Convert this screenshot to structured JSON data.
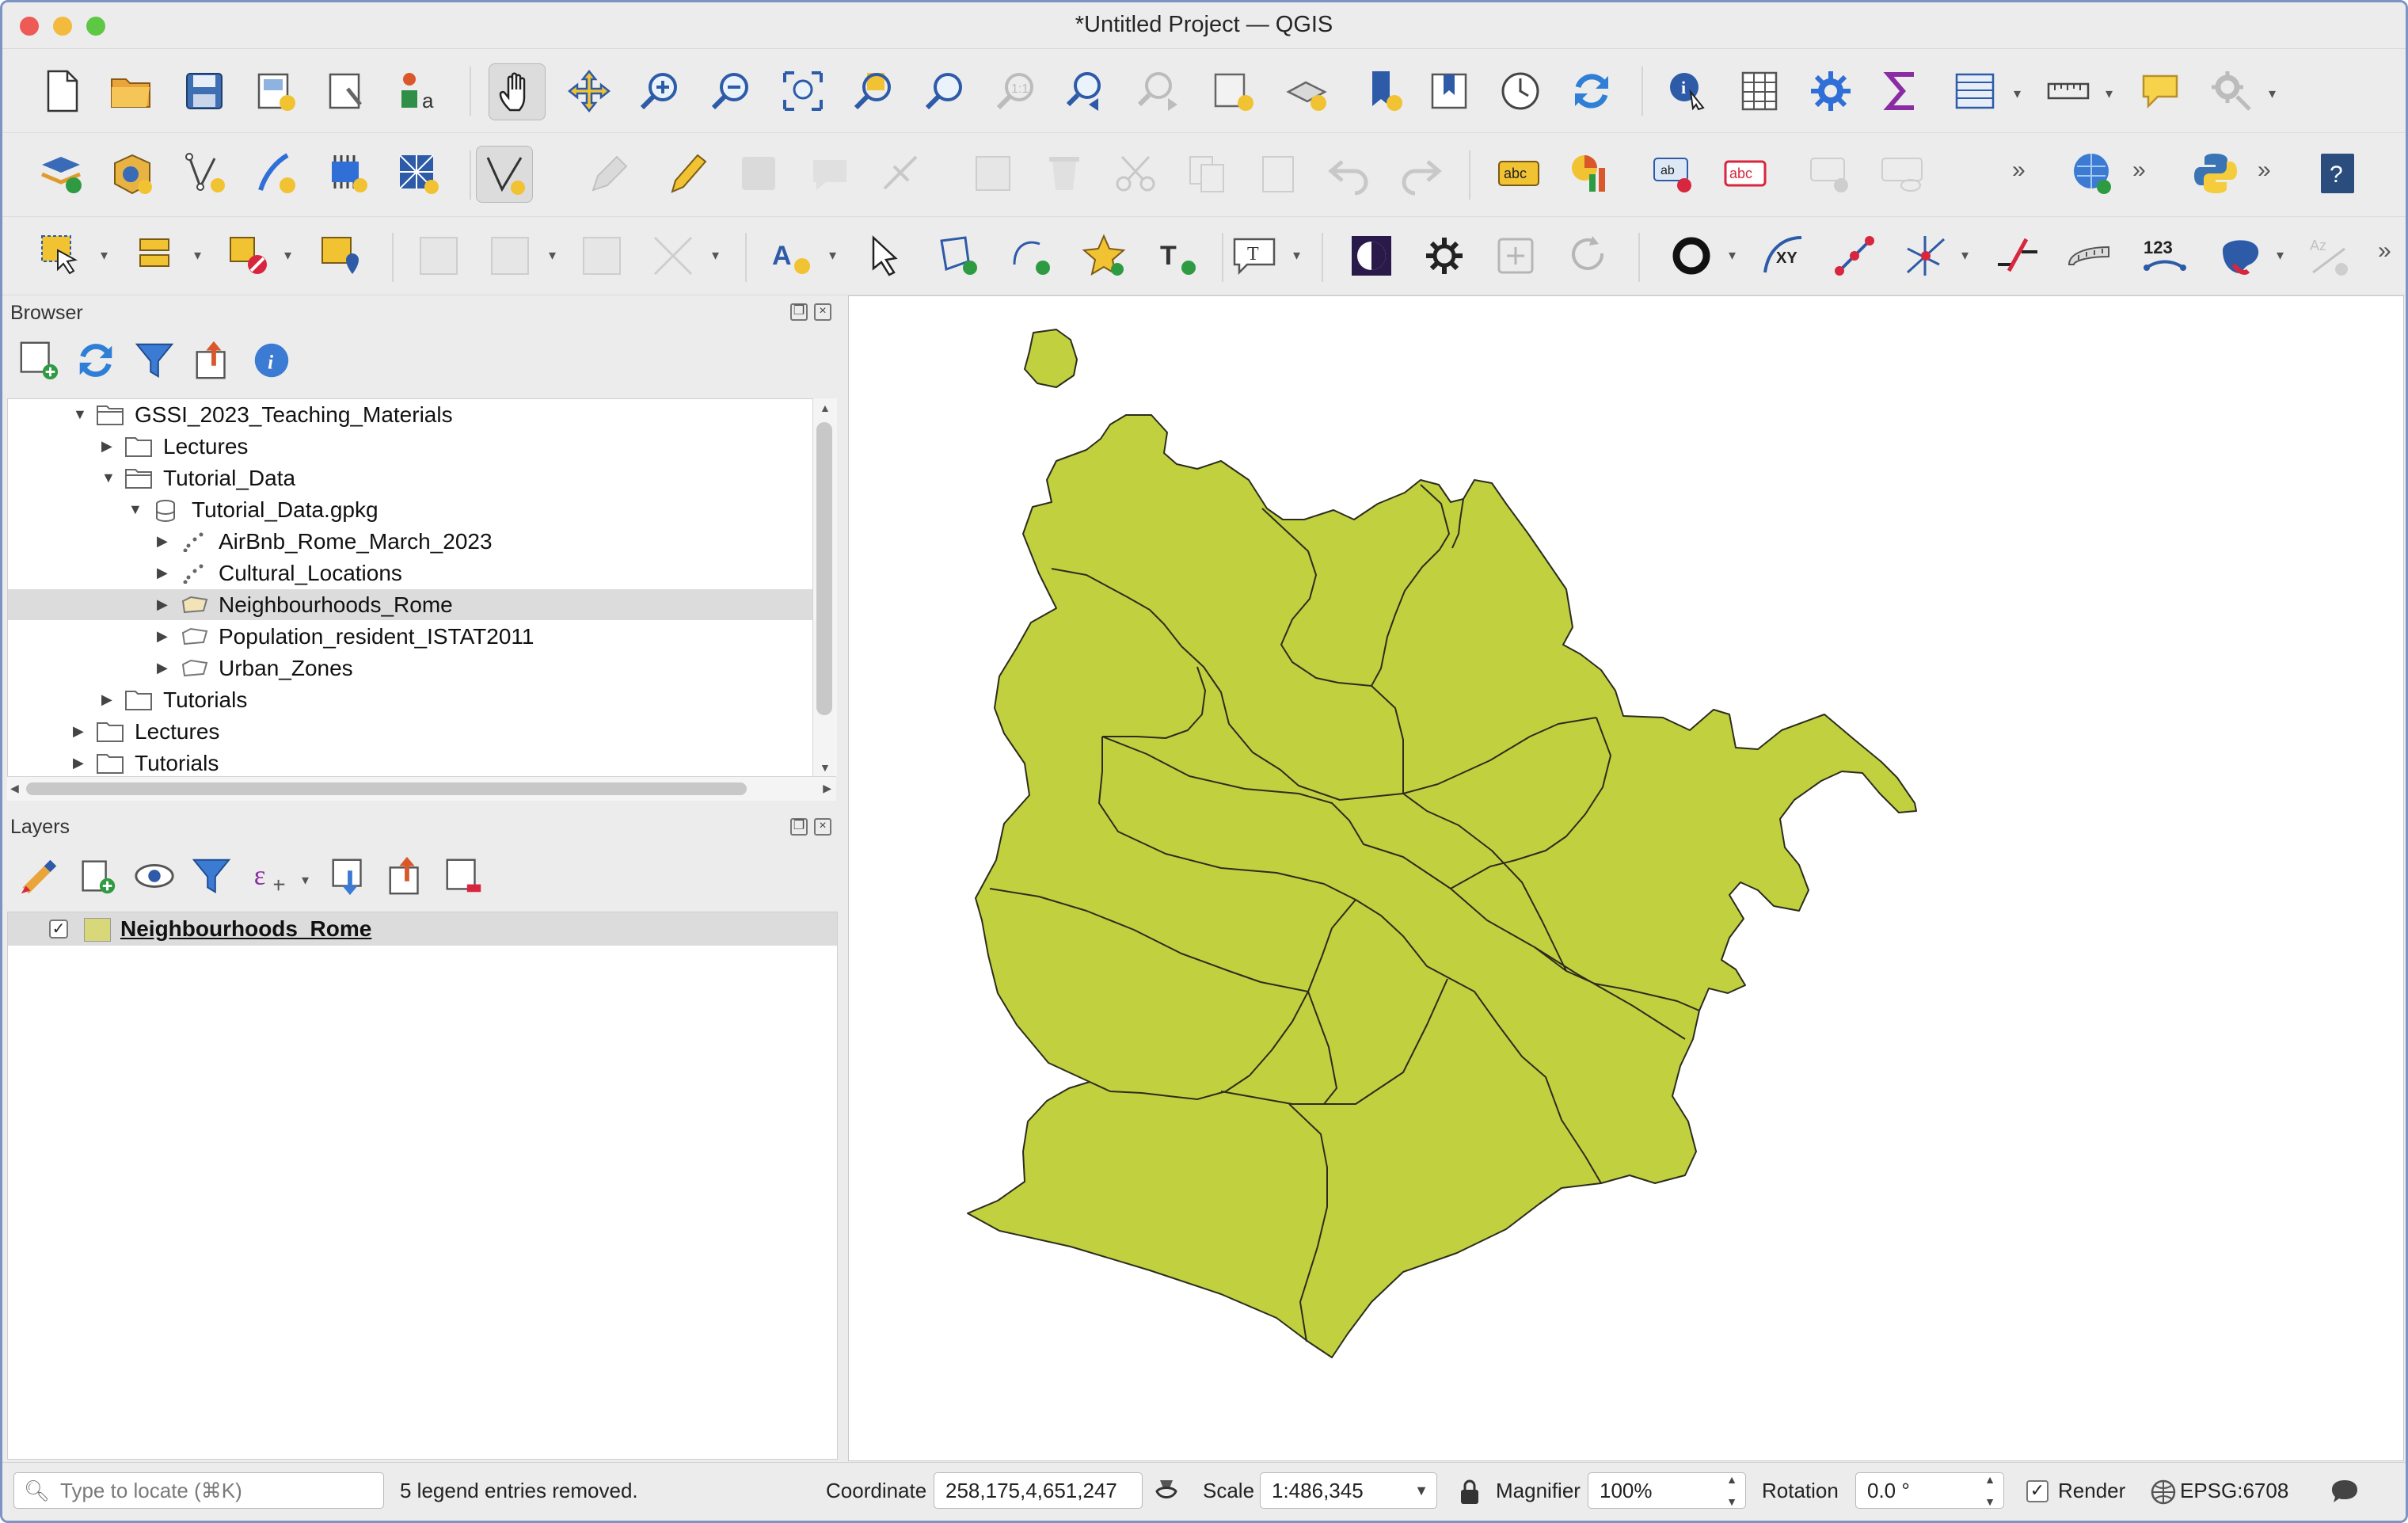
{
  "window": {
    "title": "*Untitled Project — QGIS"
  },
  "browser": {
    "title": "Browser",
    "tree": [
      {
        "label": "GSSI_2023_Teaching_Materials",
        "icon": "folder-icon"
      },
      {
        "label": "Lectures",
        "icon": "folder-icon"
      },
      {
        "label": "Tutorial_Data",
        "icon": "folder-icon"
      },
      {
        "label": "Tutorial_Data.gpkg",
        "icon": "database-icon"
      },
      {
        "label": "AirBnb_Rome_March_2023",
        "icon": "point-layer-icon"
      },
      {
        "label": "Cultural_Locations",
        "icon": "point-layer-icon"
      },
      {
        "label": "Neighbourhoods_Rome",
        "icon": "polygon-layer-icon",
        "selected": true
      },
      {
        "label": "Population_resident_ISTAT2011",
        "icon": "polygon-layer-icon"
      },
      {
        "label": "Urban_Zones",
        "icon": "polygon-layer-icon"
      },
      {
        "label": "Tutorials",
        "icon": "folder-icon"
      },
      {
        "label": "Lectures",
        "icon": "folder-icon"
      },
      {
        "label": "Tutorials",
        "icon": "folder-icon"
      }
    ]
  },
  "layers": {
    "title": "Layers",
    "items": [
      {
        "name": "Neighbourhoods_Rome",
        "checked": true,
        "swatch": "#d8d87a"
      }
    ]
  },
  "map": {
    "fill": "#c1d03f",
    "stroke": "#2c2c1e"
  },
  "status": {
    "locate_placeholder": "Type to locate (⌘K)",
    "message": "5 legend entries removed.",
    "coordinate_label": "Coordinate",
    "coordinate_value": "258,175,4,651,247",
    "scale_label": "Scale",
    "scale_value": "1:486,345",
    "magnifier_label": "Magnifier",
    "magnifier_value": "100%",
    "rotation_label": "Rotation",
    "rotation_value": "0.0 °",
    "render_label": "Render",
    "crs": "EPSG:6708"
  },
  "colors": {
    "accent": "#2f6fd6",
    "window_border": "#7d93c4",
    "selection": "#dcdcdc"
  }
}
